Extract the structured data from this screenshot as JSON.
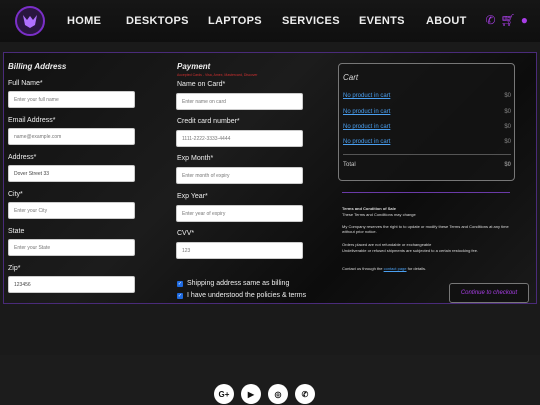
{
  "nav": {
    "links": [
      "HOME",
      "DESKTOPS",
      "LAPTOPS",
      "SERVICES",
      "EVENTS",
      "ABOUT"
    ]
  },
  "billing": {
    "title": "Billing Address",
    "full_name_label": "Full Name*",
    "full_name_placeholder": "Enter your full name",
    "email_label": "Email Address*",
    "email_placeholder": "name@example.com",
    "address_label": "Address*",
    "address_value": "Dover Street 33",
    "city_label": "City*",
    "city_placeholder": "Enter your City",
    "state_label": "State",
    "state_placeholder": "Enter your State",
    "zip_label": "Zip*",
    "zip_value": "123456"
  },
  "payment": {
    "title": "Payment",
    "accepted_cards": "Accepted Cards - Visa, Amex, Mastercard, Discover",
    "name_label": "Name on Card*",
    "name_placeholder": "Enter name on card",
    "card_label": "Credit card number*",
    "card_placeholder": "1111-2222-3333-4444",
    "exp_month_label": "Exp Month*",
    "exp_month_placeholder": "Enter month of expiry",
    "exp_year_label": "Exp Year*",
    "exp_year_placeholder": "Enter year of expiry",
    "cvv_label": "CVV*",
    "cvv_placeholder": "123",
    "shipping_same": "Shipping address same as billing",
    "policies": "I have understood the policies & terms"
  },
  "cart": {
    "title": "Cart",
    "rows": [
      {
        "label": "No product in cart",
        "value": "$0"
      },
      {
        "label": "No product in cart",
        "value": "$0"
      },
      {
        "label": "No product in cart",
        "value": "$0"
      },
      {
        "label": "No product in cart",
        "value": "$0"
      }
    ],
    "total_label": "Total",
    "total_value": "$0"
  },
  "terms": {
    "title": "Terms and Condition of Sale",
    "line1": "These Terms and Conditions may change",
    "line2": "My Company reserves the right to to update or modify these Terms and Conditions at any time without prior notice.",
    "line3": "Orders placed are not refundable or exchangeable",
    "line4": "Undeliverable or refused shipments are subjected to a certain restocking fee.",
    "contact_pre": "Contact us through the ",
    "contact_link": "contact page",
    "contact_post": " for details."
  },
  "checkout_label": "Continue to checkout",
  "social": [
    "G+",
    "▶",
    "◎",
    "✆"
  ]
}
